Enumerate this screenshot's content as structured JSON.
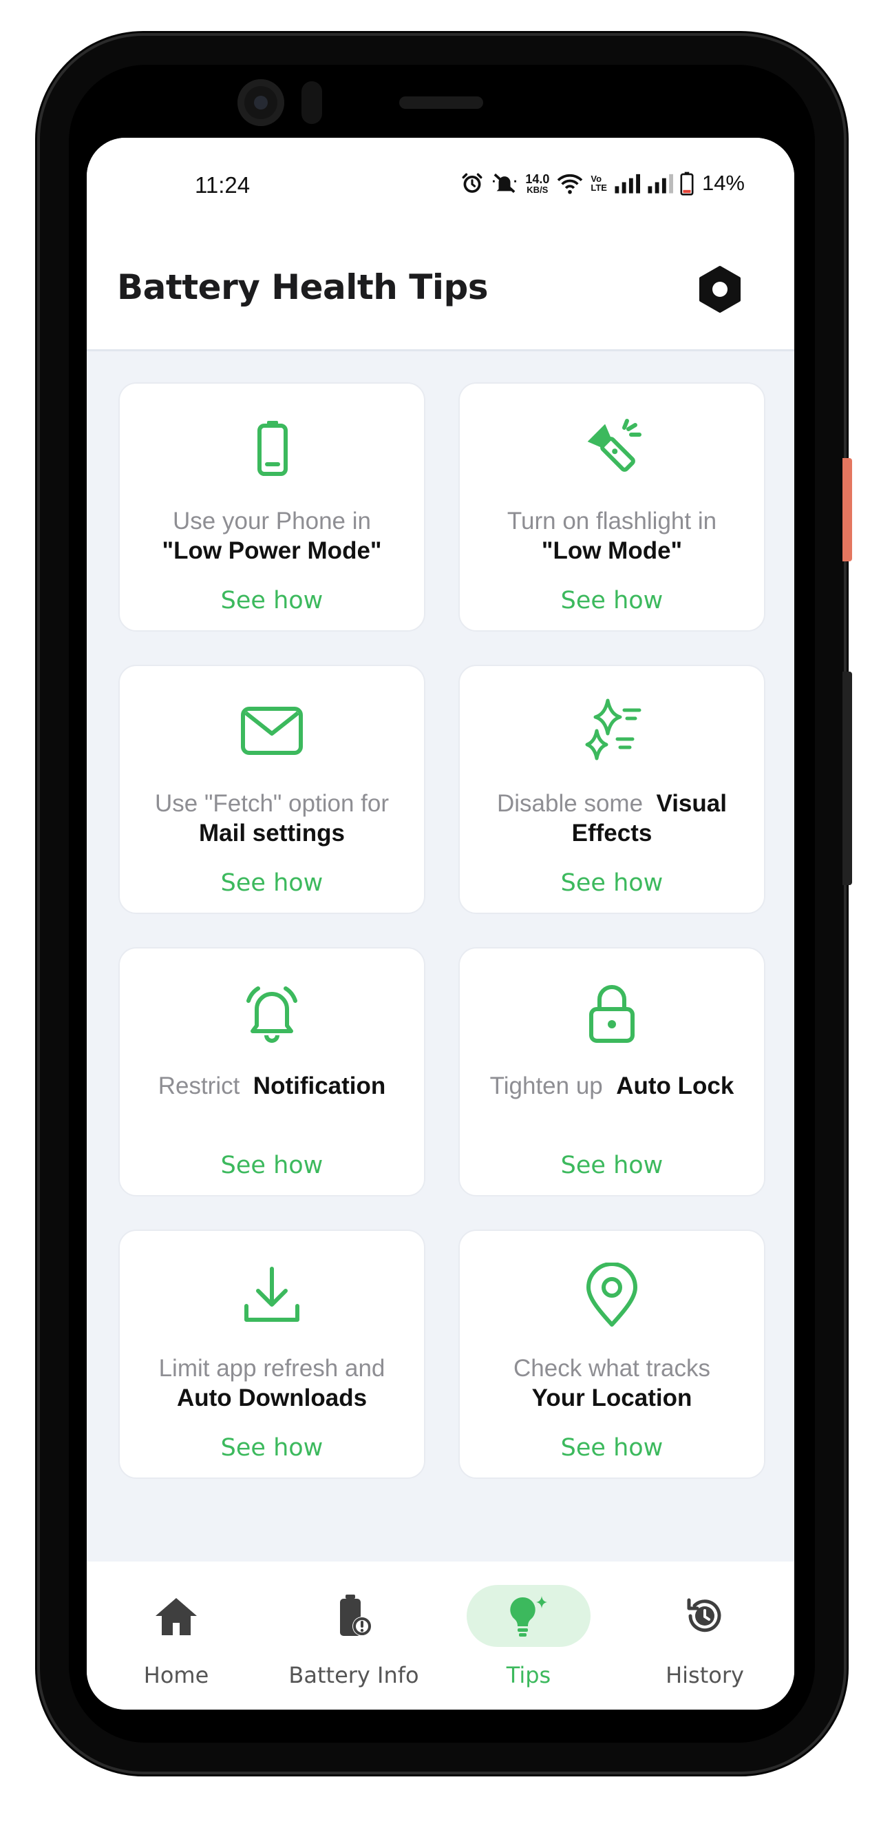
{
  "status_bar": {
    "time": "11:24",
    "net_speed": "14.0",
    "net_speed_unit": "KB/S",
    "volte_top": "Vo",
    "volte_bottom": "LTE",
    "battery_percent": "14%"
  },
  "header": {
    "title": "Battery Health Tips",
    "settings_icon": "hexagon-settings-icon"
  },
  "accent_color": "#3cb95d",
  "tips": [
    {
      "icon": "battery-low-icon",
      "line1": "Use your Phone in",
      "line2": "\"Low Power Mode\"",
      "action": "See how"
    },
    {
      "icon": "flashlight-icon",
      "line1": "Turn on flashlight in",
      "line2": "\"Low Mode\"",
      "action": "See how"
    },
    {
      "icon": "mail-icon",
      "line1": "Use \"Fetch\" option for",
      "line2": "Mail settings",
      "action": "See how"
    },
    {
      "icon": "sparkles-icon",
      "line1": "Disable some",
      "line1_bold": "Visual",
      "line2": "Effects",
      "action": "See how"
    },
    {
      "icon": "bell-icon",
      "line1": "Restrict",
      "line1_bold": "Notification",
      "action": "See how"
    },
    {
      "icon": "lock-icon",
      "line1": "Tighten up",
      "line1_bold": "Auto Lock",
      "action": "See how"
    },
    {
      "icon": "download-icon",
      "line1": "Limit app refresh and",
      "line2": "Auto Downloads",
      "action": "See how"
    },
    {
      "icon": "location-pin-icon",
      "line1": "Check what tracks",
      "line2": "Your Location",
      "action": "See how"
    }
  ],
  "bottom_nav": [
    {
      "label": "Home",
      "icon": "home-icon",
      "active": false
    },
    {
      "label": "Battery Info",
      "icon": "battery-info-icon",
      "active": false
    },
    {
      "label": "Tips",
      "icon": "lightbulb-icon",
      "active": true
    },
    {
      "label": "History",
      "icon": "history-icon",
      "active": false
    }
  ]
}
